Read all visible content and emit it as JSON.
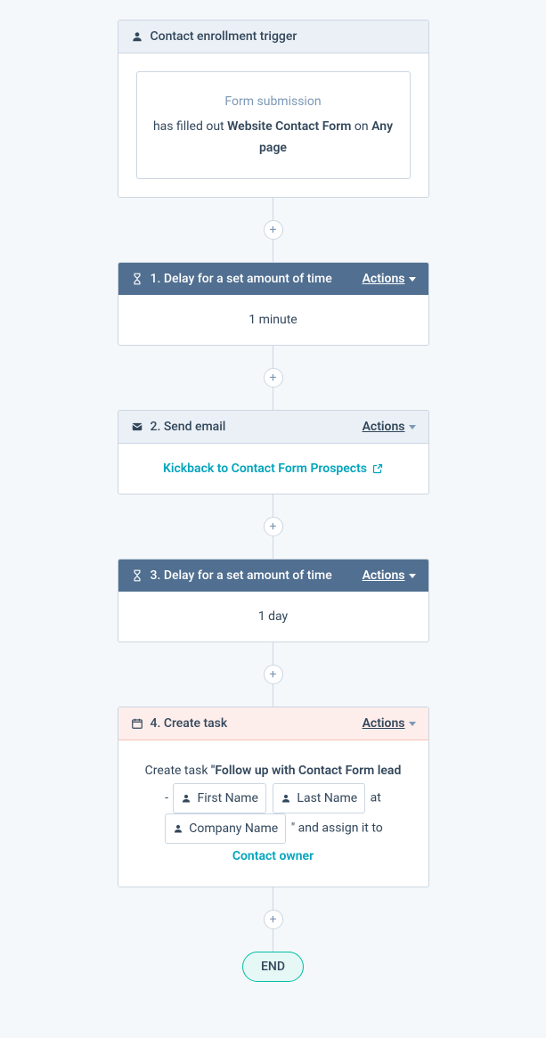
{
  "trigger": {
    "header": "Contact enrollment trigger",
    "type": "Form submission",
    "prefix": "has filled out ",
    "form_name": "Website Contact Form",
    "on_word": " on ",
    "page": "Any page"
  },
  "actions_label": "Actions",
  "steps": {
    "step1": {
      "header": "1. Delay for a set amount of time",
      "body": "1 minute"
    },
    "step2": {
      "header": "2. Send email",
      "link": "Kickback to Contact Form Prospects"
    },
    "step3": {
      "header": "3. Delay for a set amount of time",
      "body": "1 day"
    },
    "step4": {
      "header": "4. Create task",
      "prefix": "Create task ",
      "task_name": "\"Follow up with Contact Form lead",
      "dash": " - ",
      "token_first": "First Name",
      "token_last": "Last Name",
      "at_word": " at ",
      "token_company": "Company Name",
      "suffix": "\" and assign it to",
      "assignee": "Contact owner"
    }
  },
  "plus": "+",
  "end": "END"
}
